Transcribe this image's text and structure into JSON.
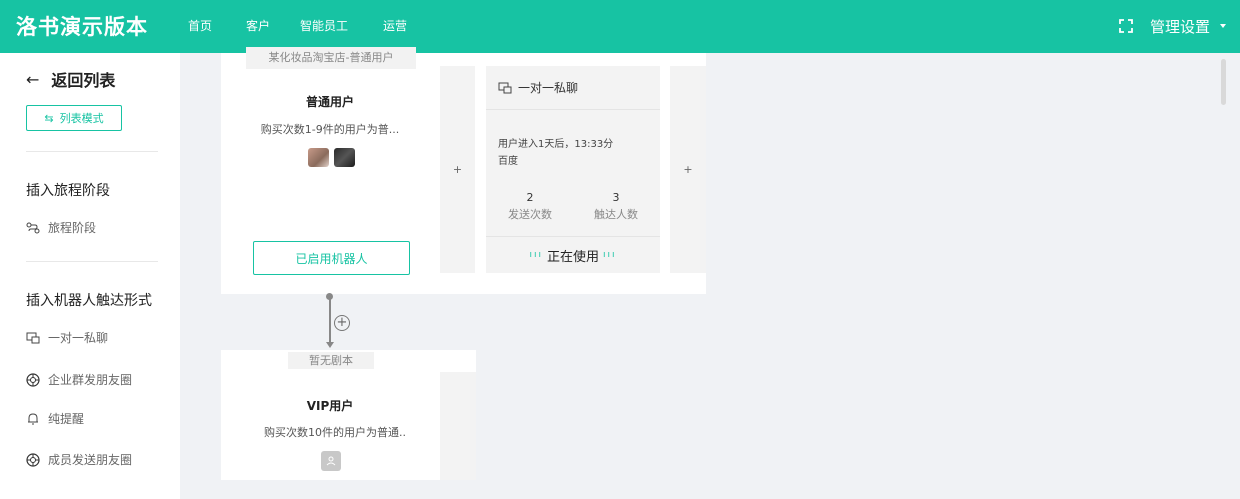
{
  "brand": "洛书演示版本",
  "nav": [
    "首页",
    "客户",
    "智能员工",
    "运营"
  ],
  "header_right": {
    "label": "管理设置",
    "fullscreen_icon": "fullscreen-icon",
    "caret_icon": "caret-down-icon"
  },
  "sidebar": {
    "back_label": "返回列表",
    "mode_button": "列表模式",
    "section1_title": "插入旅程阶段",
    "section1_items": [
      {
        "icon": "journey-icon",
        "label": "旅程阶段"
      }
    ],
    "section2_title": "插入机器人触达形式",
    "section2_items": [
      {
        "icon": "chat-icon",
        "label": "一对一私聊"
      },
      {
        "icon": "moments-icon",
        "label": "企业群发朋友圈"
      },
      {
        "icon": "bell-icon",
        "label": "纯提醒"
      },
      {
        "icon": "moments-icon",
        "label": "成员发送朋友圈"
      }
    ]
  },
  "stage1": {
    "tag": "某化妆品淘宝店-普通用户",
    "name": "普通用户",
    "desc": "购买次数1-9件的用户为普...",
    "robot_button": "已启用机器人",
    "add_label": "+"
  },
  "touch_card": {
    "title": "一对一私聊",
    "trigger": "用户进入1天后，13:33分",
    "source": "百度",
    "stats": [
      {
        "value": "2",
        "label": "发送次数"
      },
      {
        "value": "3",
        "label": "触达人数"
      }
    ],
    "status": "正在使用",
    "status_bars": "ııı"
  },
  "stage2": {
    "tag": "暂无剧本",
    "name": "VIP用户",
    "desc": "购买次数10件的用户为普通..",
    "add_label": "+"
  },
  "colors": {
    "brand": "#17c3a3"
  }
}
